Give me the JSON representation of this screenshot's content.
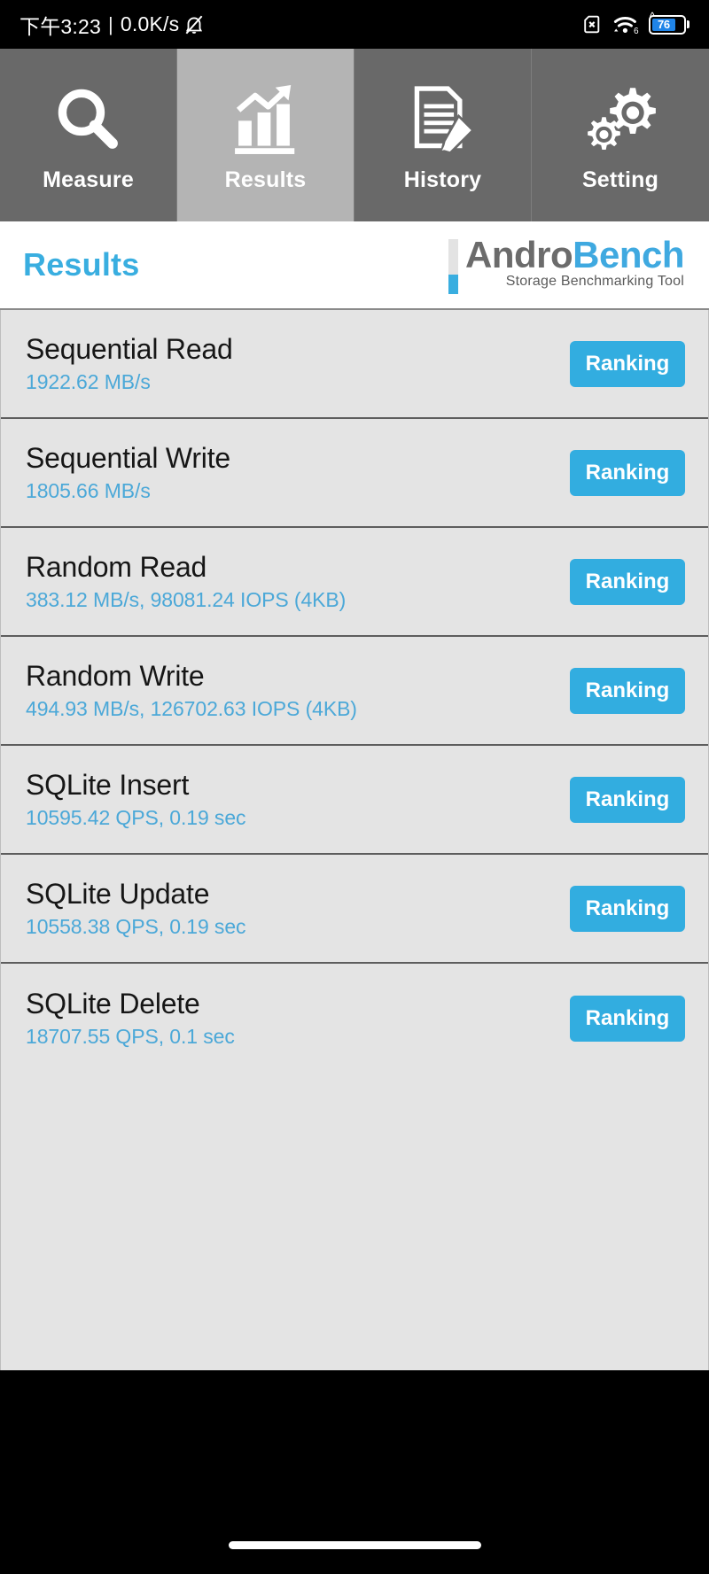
{
  "status_bar": {
    "clock": "下午3:23",
    "separator": "|",
    "network_speed": "0.0K/s",
    "icons": [
      {
        "name": "mute-bell-icon"
      },
      {
        "name": "sim-card-x-icon"
      },
      {
        "name": "wifi-6-icon"
      },
      {
        "name": "battery-charging-icon"
      }
    ],
    "battery_percent": "76"
  },
  "tabs": [
    {
      "label": "Measure",
      "icon": "magnifier-icon",
      "active": false
    },
    {
      "label": "Results",
      "icon": "bar-chart-arrow-icon",
      "active": true
    },
    {
      "label": "History",
      "icon": "document-pencil-icon",
      "active": false
    },
    {
      "label": "Setting",
      "icon": "gears-icon",
      "active": false
    }
  ],
  "header": {
    "title": "Results",
    "logo_part1": "Andro",
    "logo_part2": "Bench",
    "logo_subtitle": "Storage Benchmarking Tool"
  },
  "results": [
    {
      "title": "Sequential Read",
      "value": "1922.62 MB/s",
      "button": "Ranking"
    },
    {
      "title": "Sequential Write",
      "value": "1805.66 MB/s",
      "button": "Ranking"
    },
    {
      "title": "Random Read",
      "value": "383.12 MB/s, 98081.24 IOPS (4KB)",
      "button": "Ranking"
    },
    {
      "title": "Random Write",
      "value": "494.93 MB/s, 126702.63 IOPS (4KB)",
      "button": "Ranking"
    },
    {
      "title": "SQLite Insert",
      "value": "10595.42 QPS, 0.19 sec",
      "button": "Ranking"
    },
    {
      "title": "SQLite Update",
      "value": "10558.38 QPS, 0.19 sec",
      "button": "Ranking"
    },
    {
      "title": "SQLite Delete",
      "value": "18707.55 QPS, 0.1 sec",
      "button": "Ranking"
    }
  ],
  "colors": {
    "accent_blue": "#32ade0",
    "value_blue": "#4ba8d8",
    "title_blue": "#39aee0",
    "tab_inactive": "#696969",
    "tab_active": "#b4b4b4",
    "list_bg": "#e4e4e4",
    "logo_gray": "#6b6b6b"
  }
}
